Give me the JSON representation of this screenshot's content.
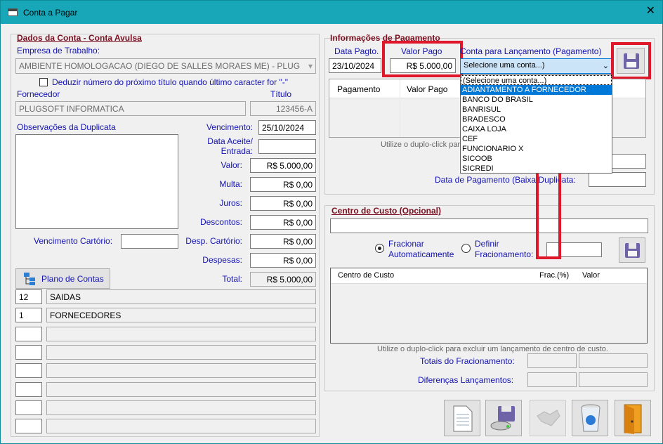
{
  "window": {
    "title": "Conta a Pagar",
    "close_glyph": "✕"
  },
  "left": {
    "section_title": "Dados da Conta - Conta Avulsa",
    "empresa_label": "Empresa de Trabalho:",
    "empresa_value": "AMBIENTE HOMOLOGACAO  (DIEGO DE SALLES MORAES ME) - PLUGSOFT",
    "deduzir_label": "Deduzir número do próximo título quando último caracter for \"-\"",
    "deduzir_checked": false,
    "fornecedor_label": "Fornecedor",
    "fornecedor_value": "PLUGSOFT INFORMATICA",
    "titulo_label": "Título",
    "titulo_value": "123456-A",
    "obs_label": "Observações da Duplicata",
    "obs_value": "",
    "vencimento_label": "Vencimento:",
    "vencimento_value": "25/10/2024",
    "data_aceite_label": "Data Aceite/\nEntrada:",
    "data_aceite_value": "",
    "valor_label": "Valor:",
    "valor_value": "R$ 5.000,00",
    "multa_label": "Multa:",
    "multa_value": "R$ 0,00",
    "juros_label": "Juros:",
    "juros_value": "R$ 0,00",
    "descontos_label": "Descontos:",
    "descontos_value": "R$ 0,00",
    "venc_cartorio_label": "Vencimento Cartório:",
    "venc_cartorio_value": "",
    "desp_cartorio_label": "Desp. Cartório:",
    "desp_cartorio_value": "R$ 0,00",
    "despesas_label": "Despesas:",
    "despesas_value": "R$ 0,00",
    "plano_button": "Plano de Contas",
    "total_label": "Total:",
    "total_value": "R$ 5.000,00",
    "plano_rows": [
      {
        "code": "12",
        "name": "SAIDAS"
      },
      {
        "code": "1",
        "name": "FORNECEDORES"
      },
      {
        "code": "",
        "name": ""
      },
      {
        "code": "",
        "name": ""
      },
      {
        "code": "",
        "name": ""
      },
      {
        "code": "",
        "name": ""
      },
      {
        "code": "",
        "name": ""
      },
      {
        "code": "",
        "name": ""
      }
    ]
  },
  "pagamento": {
    "section_title": "Informações de Pagamento",
    "data_label": "Data Pagto.",
    "data_value": "23/10/2024",
    "valor_label": "Valor Pago",
    "valor_value": "R$ 5.000,00",
    "conta_label": "Conta para Lançamento (Pagamento)",
    "conta_selected": "Selecione uma conta...)",
    "grid_headers": [
      "Pagamento",
      "Valor Pago"
    ],
    "hint": "Utilize o duplo-click para",
    "data_pag_label": "Data de Pagamento (Baixa Duplicata:",
    "data_pag_value": "",
    "options": [
      "(Selecione uma conta...)",
      "ADIANTAMENTO A FORNECEDOR",
      "BANCO DO BRASIL",
      "BANRISUL",
      "BRADESCO",
      "CAIXA LOJA",
      "CEF",
      "FUNCIONARIO X",
      "SICOOB",
      "SICREDI"
    ],
    "highlighted_option": "ADIANTAMENTO A FORNECEDOR"
  },
  "centro": {
    "section_title": "Centro de Custo (Opcional)",
    "input_value": "",
    "fracionar_label": "Fracionar\nAutomaticamente",
    "definir_label": "Definir\nFracionamento:",
    "definir_value": "",
    "selected_radio": "fracionar",
    "grid_headers": [
      "Centro de Custo",
      "Frac.(%)",
      "Valor"
    ],
    "hint": "Utilize o duplo-click para excluir um lançamento de centro de custo.",
    "totais_label": "Totais do Fracionamento:",
    "diferencas_label": "Diferenças Lançamentos:"
  },
  "icons": [
    "window-icon",
    "floppy-icon",
    "tree-icon",
    "document-icon",
    "save-drive-icon",
    "handshake-icon",
    "recycle-bin-icon",
    "exit-door-icon"
  ],
  "colors": {
    "titlebar": "#17a7b8",
    "label_blue": "#1414b0",
    "section_red": "#7a1020",
    "highlight": "#e0162a",
    "selection": "#0078d7"
  }
}
